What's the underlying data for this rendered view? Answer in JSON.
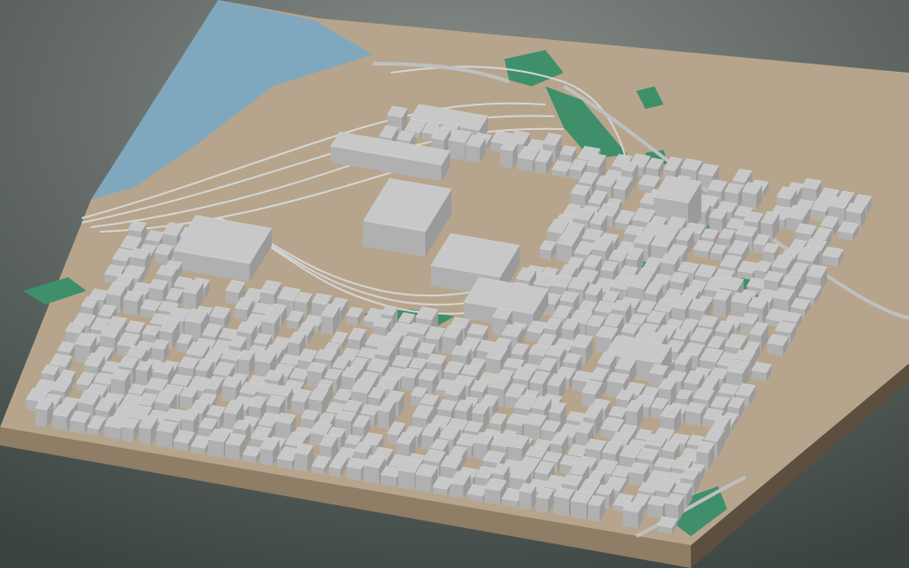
{
  "scene": {
    "kind": "3d-city-block-model",
    "view": "isometric-oblique",
    "colors": {
      "background_top": "#8a8f8b",
      "background_bottom": "#3a4340",
      "terrain": "#b6a58c",
      "base_side_left": "#8f7d66",
      "base_side_right": "#5c4f40",
      "building_top": "#c8c8c8",
      "building_left": "#b0b0b0",
      "building_right": "#9a9a9a",
      "water": "#7fa8bf",
      "park": "#3f8f6a",
      "rail": "#d4d4d4"
    },
    "layers": [
      "terrain-base",
      "water-area",
      "park-areas",
      "rail-yard",
      "roads",
      "buildings"
    ]
  }
}
